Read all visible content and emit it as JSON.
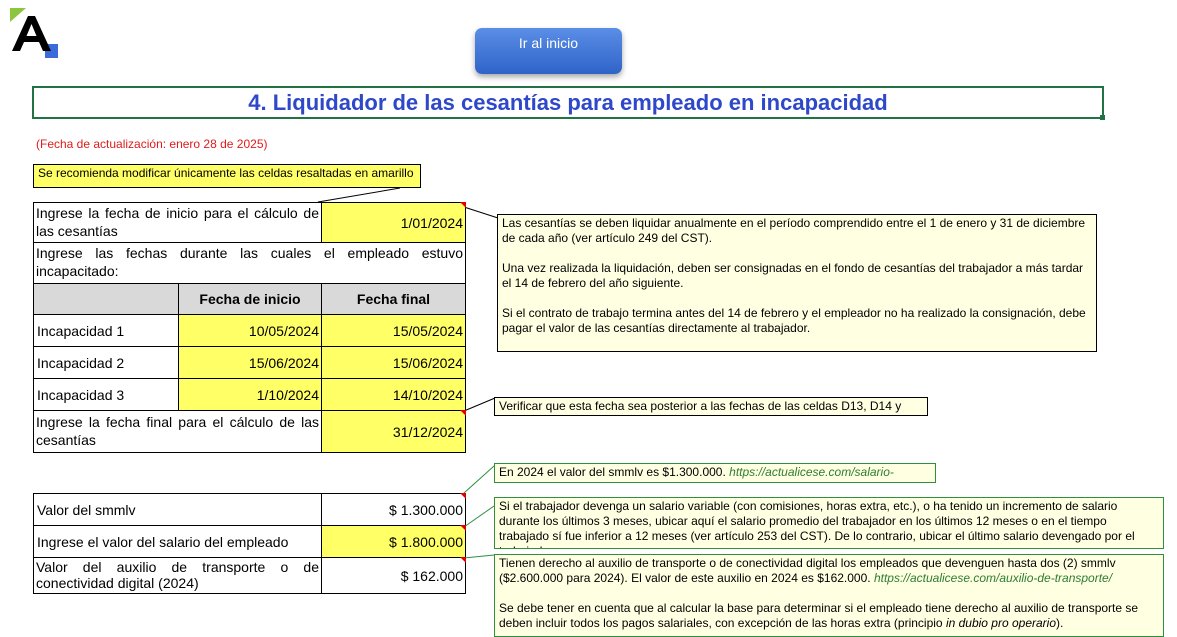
{
  "header": {
    "home_button": "Ir al inicio",
    "title": "4. Liquidador de las cesantías para empleado en incapacidad",
    "update_date": "(Fecha de actualización: enero 28 de 2025)",
    "recommendation": "Se recomienda modificar únicamente las celdas resaltadas en amarillo"
  },
  "form": {
    "start_label": "Ingrese la fecha de inicio para el cálculo de las cesantías",
    "start_value": "1/01/2024",
    "incap_intro": "Ingrese las fechas durante las cuales el empleado estuvo incapacitado:",
    "col_start": "Fecha de inicio",
    "col_end": "Fecha final",
    "rows": [
      {
        "label": "Incapacidad 1",
        "start": "10/05/2024",
        "end": "15/05/2024"
      },
      {
        "label": "Incapacidad 2",
        "start": "15/06/2024",
        "end": "15/06/2024"
      },
      {
        "label": "Incapacidad 3",
        "start": "1/10/2024",
        "end": "14/10/2024"
      }
    ],
    "end_label": "Ingrese la fecha final para el cálculo de las cesantías",
    "end_value": "31/12/2024",
    "smmlv_label": "Valor del smmlv",
    "smmlv_value": "$ 1.300.000",
    "salary_label": "Ingrese el valor del salario del empleado",
    "salary_value": "$ 1.800.000",
    "transport_label": "Valor del auxilio de transporte o de conectividad digital (2024)",
    "transport_value": "$ 162.000"
  },
  "comments": {
    "cesantias_p1": "Las cesantías se deben liquidar anualmente en el período comprendido entre el 1 de enero y 31 de diciembre de cada año (ver artículo 249 del CST).",
    "cesantias_p2": "Una vez realizada la liquidación, deben ser consignadas en el fondo de cesantías del trabajador a más tardar el 14 de febrero del año siguiente.",
    "cesantias_p3": "Si el contrato de trabajo termina antes del 14 de febrero y el empleador no ha realizado la consignación, debe pagar el valor de las cesantías directamente al trabajador.",
    "verify": "Verificar que esta fecha sea posterior a las fechas de las celdas D13, D14 y D15",
    "smmlv_text": "En 2024 el valor del smmlv es $1.300.000.",
    "smmlv_link": "https://actualicese.com/salario-minimo/",
    "salary_note": "Si el trabajador devenga un salario variable (con comisiones, horas extra, etc.), o ha tenido un incremento de salario durante los últimos 3 meses, ubicar aquí el salario promedio del trabajador en los últimos 12 meses o en el tiempo trabajado sí fue inferior a 12 meses (ver artículo 253 del CST). De lo contrario, ubicar el último salario devengado por el trabajador.",
    "transport_text": "Tienen derecho al auxilio de transporte o de conectividad digital los empleados que devenguen hasta dos (2) smmlv ($2.600.000 para 2024). El valor de este auxilio en 2024 es $162.000.",
    "transport_link": "https://actualicese.com/auxilio-de-transporte/",
    "transport_p2_a": "Se debe tener en cuenta que al calcular la base para determinar si el empleado tiene derecho al auxilio de transporte se deben incluir todos los pagos salariales, con excepción de las horas extra (principio",
    "transport_p2_em": "in dubio pro operario",
    "transport_p2_b": ")."
  },
  "colors": {
    "title": "#2e48c9",
    "highlight": "#ffff66",
    "comment_bg": "#ffffe1",
    "button": "#3a6fd6",
    "date_red": "#e01b1b"
  }
}
